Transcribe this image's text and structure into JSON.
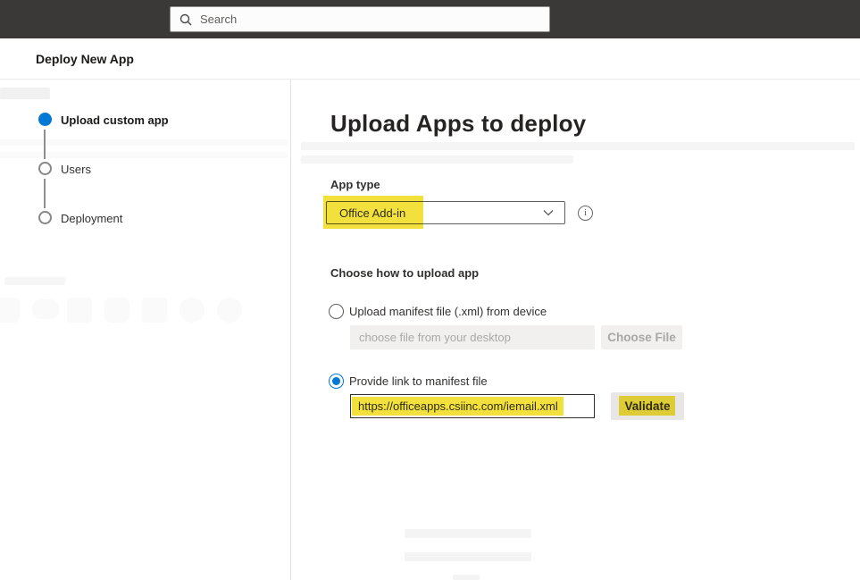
{
  "topbar": {
    "search_placeholder": "Search"
  },
  "header": {
    "title": "Deploy New App"
  },
  "stepper": {
    "steps": [
      {
        "label": "Upload custom app",
        "state": "active"
      },
      {
        "label": "Users",
        "state": "pending"
      },
      {
        "label": "Deployment",
        "state": "pending"
      }
    ]
  },
  "main": {
    "title": "Upload Apps to deploy",
    "app_type_label": "App type",
    "app_type_value": "Office Add-in",
    "upload_label": "Choose how to upload app",
    "option_file": {
      "label": "Upload manifest file (.xml) from device",
      "selected": false,
      "placeholder": "choose file from your desktop",
      "button": "Choose File"
    },
    "option_link": {
      "label": "Provide link to manifest file",
      "selected": true,
      "value": "https://officeapps.csiinc.com/iemail.xml",
      "button": "Validate"
    }
  },
  "icons": {
    "search": "search-icon",
    "chevron": "chevron-down-icon",
    "info": "info-icon"
  },
  "colors": {
    "topbar_bg": "#3a3938",
    "accent_blue": "#0078d4",
    "highlight_yellow": "#f2e13c",
    "disabled_bg": "#f1f0ef",
    "button_bg": "#e9e7e5"
  }
}
